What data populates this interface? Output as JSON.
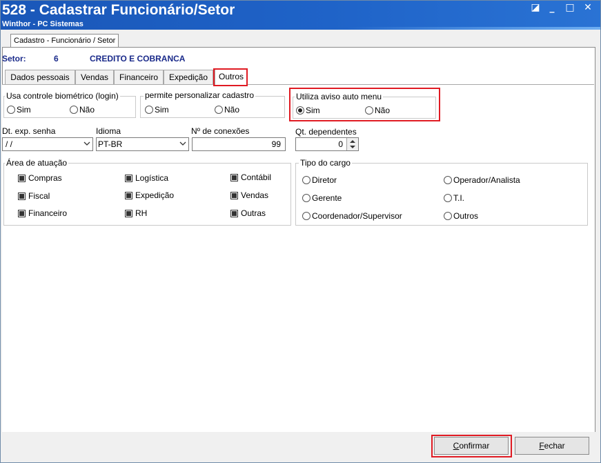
{
  "window": {
    "title": "528 - Cadastrar Funcionário/Setor",
    "subtitle": "Winthor - PC Sistemas",
    "controls": {
      "restore": "◪",
      "minimize": "_",
      "maximize": "□",
      "close": "✕"
    }
  },
  "outer_tab": "Cadastro - Funcionário / Setor",
  "setor": {
    "label": "Setor:",
    "number": "6",
    "name": "CREDITO E COBRANCA"
  },
  "tabs": [
    "Dados pessoais",
    "Vendas",
    "Financeiro",
    "Expedição",
    "Outros"
  ],
  "active_tab": "Outros",
  "biometrico": {
    "title": "Usa controle biométrico (login)",
    "opt_sim": "Sim",
    "opt_nao": "Não",
    "selected": "none"
  },
  "personalizar": {
    "title": "permite personalizar cadastro",
    "opt_sim": "Sim",
    "opt_nao": "Não",
    "selected": "none"
  },
  "aviso_menu": {
    "title": "Utiliza aviso auto menu",
    "opt_sim": "Sim",
    "opt_nao": "Não",
    "selected": "Sim"
  },
  "fields": {
    "exp_senha": {
      "label": "Dt. exp. senha",
      "value": " /  /"
    },
    "idioma": {
      "label": "Idioma",
      "value": "PT-BR"
    },
    "conexoes": {
      "label": "Nº de conexões",
      "value": "99"
    },
    "dependentes": {
      "label": "Qt. dependentes",
      "value": "0"
    }
  },
  "area_atuacao": {
    "title": "Área de atuação",
    "items": [
      "Compras",
      "Logística",
      "Contábil",
      "Fiscal",
      "Expedição",
      "Vendas",
      "Financeiro",
      "RH",
      "Outras"
    ]
  },
  "tipo_cargo": {
    "title": "Tipo do cargo",
    "items": [
      "Diretor",
      "Operador/Analista",
      "Gerente",
      "T.I.",
      "Coordenador/Supervisor",
      "Outros"
    ]
  },
  "buttons": {
    "confirmar_first": "C",
    "confirmar_rest": "onfirmar",
    "fechar_first": "F",
    "fechar_rest": "echar"
  },
  "colors": {
    "title_bar": "#1f63c8",
    "highlight": "#e01a22",
    "setor_text": "#1a2a8a"
  }
}
